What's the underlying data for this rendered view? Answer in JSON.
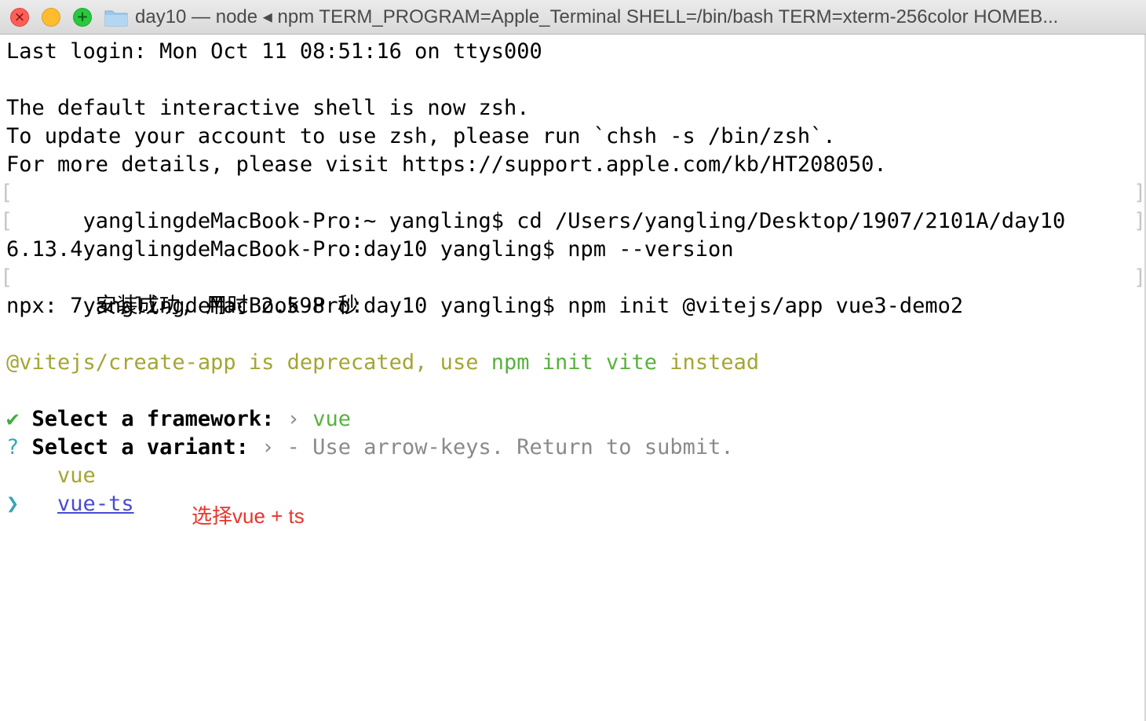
{
  "window": {
    "title": "day10 — node ◂ npm TERM_PROGRAM=Apple_Terminal SHELL=/bin/bash TERM=xterm-256color HOMEB..."
  },
  "terminal": {
    "lines": [
      "Last login: Mon Oct 11 08:51:16 on ttys000",
      "",
      "The default interactive shell is now zsh.",
      "To update your account to use zsh, please run `chsh -s /bin/zsh`.",
      "For more details, please visit https://support.apple.com/kb/HT208050.",
      "yanglingdeMacBook-Pro:~ yangling$ cd /Users/yangling/Desktop/1907/2101A/day10",
      "yanglingdeMacBook-Pro:day10 yangling$ npm --version",
      "6.13.4",
      "yanglingdeMacBook-Pro:day10 yangling$ npm init @vitejs/app vue3-demo2",
      "npx: 7 安装成功, 用时 2.598 秒",
      ""
    ],
    "deprecation": {
      "part1": "@vitejs/create-app is deprecated, use ",
      "part2": "npm init vite",
      "part3": " instead"
    },
    "framework_prompt": {
      "symbol": "✔",
      "label": "Select a framework:",
      "arrow": "›",
      "value": "vue"
    },
    "variant_prompt": {
      "symbol": "?",
      "label": "Select a variant:",
      "arrow": "›",
      "hint": "- Use arrow-keys. Return to submit."
    },
    "options": [
      {
        "label": "vue",
        "selected": false
      },
      {
        "label": "vue-ts",
        "selected": true
      }
    ],
    "cursor_symbol": "❯"
  },
  "annotation": "选择vue + ts",
  "colors": {
    "deprecated": "#a4a534",
    "vite_hint": "#57b23d",
    "check": "#3dae3d",
    "question": "#3aa5b7",
    "selected": "#4a4bd0",
    "annotation": "#e8352b"
  }
}
